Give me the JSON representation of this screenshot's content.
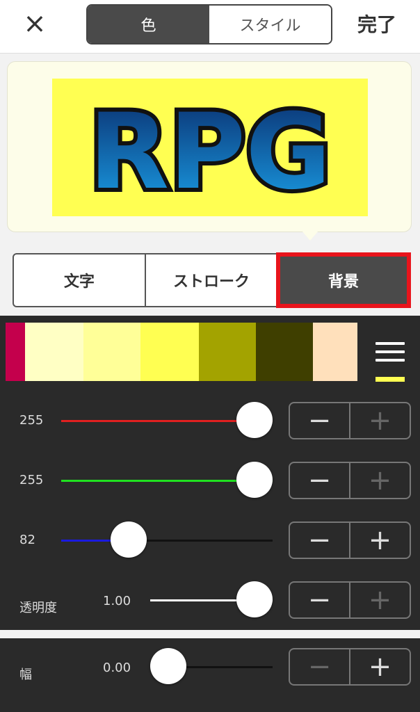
{
  "header": {
    "close_icon": "×",
    "tabs": [
      "色",
      "スタイル"
    ],
    "done_label": "完了"
  },
  "preview": {
    "text": "RPG",
    "background_color": "#ffff52"
  },
  "target_tabs": [
    "文字",
    "ストローク",
    "背景"
  ],
  "palette": {
    "swatches": [
      "#c4004c",
      "#ffffc4",
      "#ffff98",
      "#ffff52",
      "#a3a300",
      "#3f3f00",
      "#ffe0bb"
    ],
    "menu_icon": "menu-icon"
  },
  "sliders": {
    "red": {
      "value": "255",
      "fraction": 1.0,
      "color": "#e02020"
    },
    "green": {
      "value": "255",
      "fraction": 1.0,
      "color": "#20e020"
    },
    "blue": {
      "value": "82",
      "fraction": 0.32,
      "color": "#1a1ae0"
    },
    "opacity": {
      "label": "透明度",
      "value": "1.00",
      "fraction": 1.0,
      "color": "#ffffff"
    },
    "width": {
      "label": "幅",
      "value": "0.00",
      "fraction": 0.0,
      "color": "#ffffff"
    }
  },
  "stepper": {
    "minus": "−",
    "plus": "+"
  }
}
